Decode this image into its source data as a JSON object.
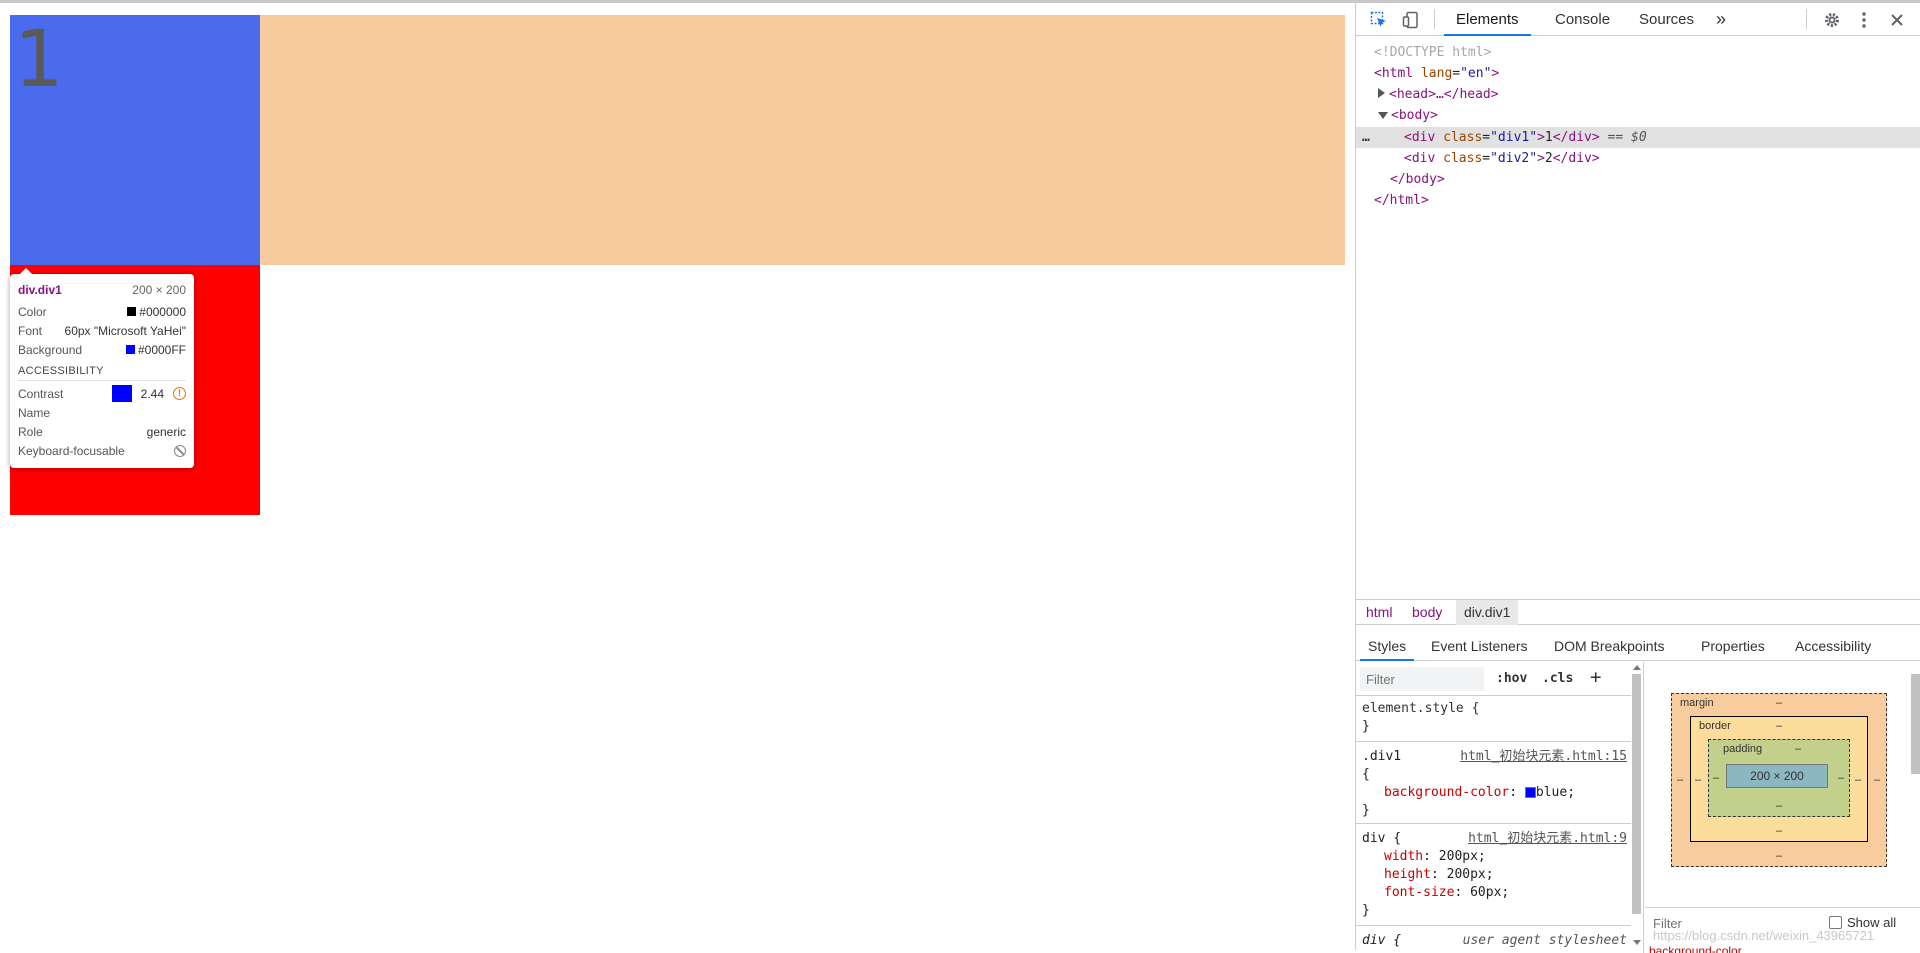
{
  "page": {
    "div1_text": "1",
    "div1_color": "#4a6cec",
    "div1_margin_color": "#f7cb9c",
    "div2_color": "#ff0000"
  },
  "tooltip": {
    "title": "div.div1",
    "size": "200 × 200",
    "color_label": "Color",
    "color_value": "#000000",
    "font_label": "Font",
    "font_value": "60px \"Microsoft YaHei\"",
    "background_label": "Background",
    "background_value": "#0000FF",
    "section": "ACCESSIBILITY",
    "contrast_label": "Contrast",
    "contrast_value": "2.44",
    "name_label": "Name",
    "role_label": "Role",
    "role_value": "generic",
    "keyboard_label": "Keyboard-focusable"
  },
  "devtools": {
    "tabs": [
      "Elements",
      "Console",
      "Sources"
    ],
    "more": "»",
    "dom": {
      "doctype": "<!DOCTYPE html>",
      "html_open_tag": "<html",
      "html_attr": "lang",
      "html_attr_val": "\"en\"",
      "head": "<head>…</head>",
      "body_open": "<body>",
      "div1_open": "<div",
      "div1_attr": "class",
      "div1_val": "\"div1\"",
      "div1_text": "1",
      "div1_close": "</div>",
      "div1_marker": "== $0",
      "div2_open": "<div",
      "div2_attr": "class",
      "div2_val": "\"div2\"",
      "div2_text": "2",
      "div2_close": "</div>",
      "body_close": "</body>",
      "html_close": "</html>",
      "ellipsis": "…"
    },
    "breadcrumbs": [
      "html",
      "body",
      "div.div1"
    ],
    "subtabs": [
      "Styles",
      "Event Listeners",
      "DOM Breakpoints",
      "Properties",
      "Accessibility"
    ],
    "styles": {
      "filter_placeholder": "Filter",
      "hov": ":hov",
      "cls": ".cls",
      "plus": "+",
      "element_style": "element.style {",
      "close_brace": "}",
      "rule1_selector": ".div1",
      "rule1_source": "html_初始块元素.html:15",
      "rule1_open": "{",
      "rule1_prop": "background-color",
      "rule1_val": "blue;",
      "rule2_selector": "div {",
      "rule2_source": "html_初始块元素.html:9",
      "rule2_props": [
        {
          "name": "width",
          "value": "200px;"
        },
        {
          "name": "height",
          "value": "200px;"
        },
        {
          "name": "font-size",
          "value": "60px;"
        }
      ],
      "rule3_selector": "div {",
      "rule3_source": "user agent stylesheet"
    },
    "boxmodel": {
      "margin": "margin",
      "border": "border",
      "padding": "padding",
      "content": "200 × 200",
      "dash": "–",
      "filter_placeholder": "Filter",
      "show_all": "Show all",
      "watermark": "https://blog.csdn.net/weixin_43965721",
      "bg_prop": "background-color"
    }
  }
}
